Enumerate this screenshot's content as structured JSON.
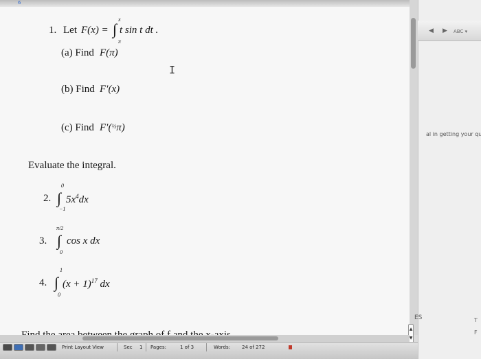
{
  "document": {
    "top_marker": "6",
    "q1": {
      "number": "1.",
      "lead": "Let",
      "func": "F(x) =",
      "integral_upper": "x",
      "integral_lower": "π",
      "integrand": "t sin t dt .",
      "a": "(a) Find",
      "a_expr": "F(π)",
      "b": "(b) Find",
      "b_expr": "F′(x)",
      "c": "(c) Find",
      "c_expr_pre": "F′(",
      "c_frac": "½",
      "c_expr_post": "π)"
    },
    "evaluate_heading": "Evaluate the integral.",
    "q2": {
      "number": "2.",
      "upper": "0",
      "lower": "−1",
      "integrand": "5x",
      "power": "4",
      "dx": "dx"
    },
    "q3": {
      "number": "3.",
      "upper": "π/2",
      "lower": "0",
      "integrand": "cos x dx"
    },
    "q4": {
      "number": "4.",
      "upper": "1",
      "lower": "0",
      "integrand": "(x + 1)",
      "power": "17",
      "dx": "dx"
    },
    "area_heading": "Find the area between the graph of f and the x-axis."
  },
  "cursor": "I",
  "right_panel": {
    "toolbar_icons": [
      "◀",
      "▶",
      "ABC ▾"
    ],
    "snippet": "al in getting your que",
    "es_label": "ES",
    "t_label": "T",
    "f_label": "F"
  },
  "status_bar": {
    "view_mode": "Print Layout View",
    "sec_label": "Sec",
    "sec_value": "1",
    "pages_label": "Pages:",
    "pages_value": "1 of 3",
    "words_label": "Words:",
    "words_value": "24 of 272"
  },
  "colors": {
    "accent": "#3b6fd0",
    "status_red": "#c0392b"
  }
}
